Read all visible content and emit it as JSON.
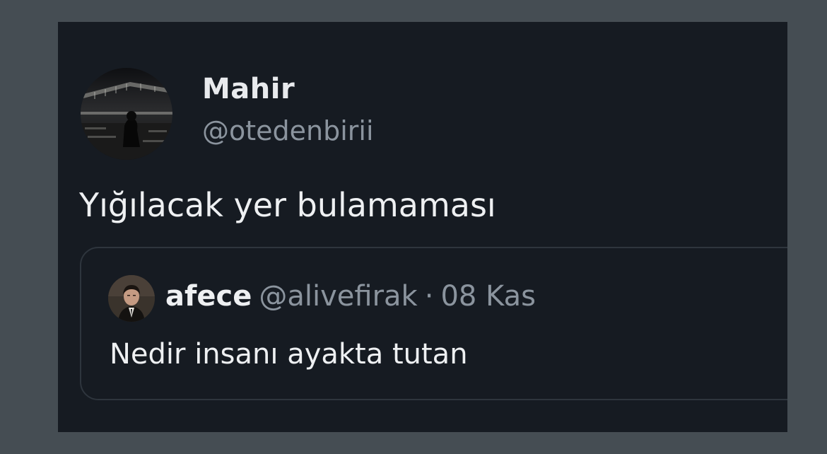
{
  "tweet": {
    "author": {
      "display_name": "Mahir",
      "handle": "@otedenbirii"
    },
    "text": "Yığılacak yer bulamaması"
  },
  "quoted_tweet": {
    "author": {
      "display_name": "afece",
      "handle": "@alivefirak"
    },
    "separator": "·",
    "date": "08 Kas",
    "text": "Nedir insanı ayakta tutan"
  },
  "colors": {
    "page_background": "#454d53",
    "card_background": "#161b22",
    "primary_text": "#eef0f2",
    "secondary_text": "#8b949e",
    "quote_border": "#2e353d"
  }
}
